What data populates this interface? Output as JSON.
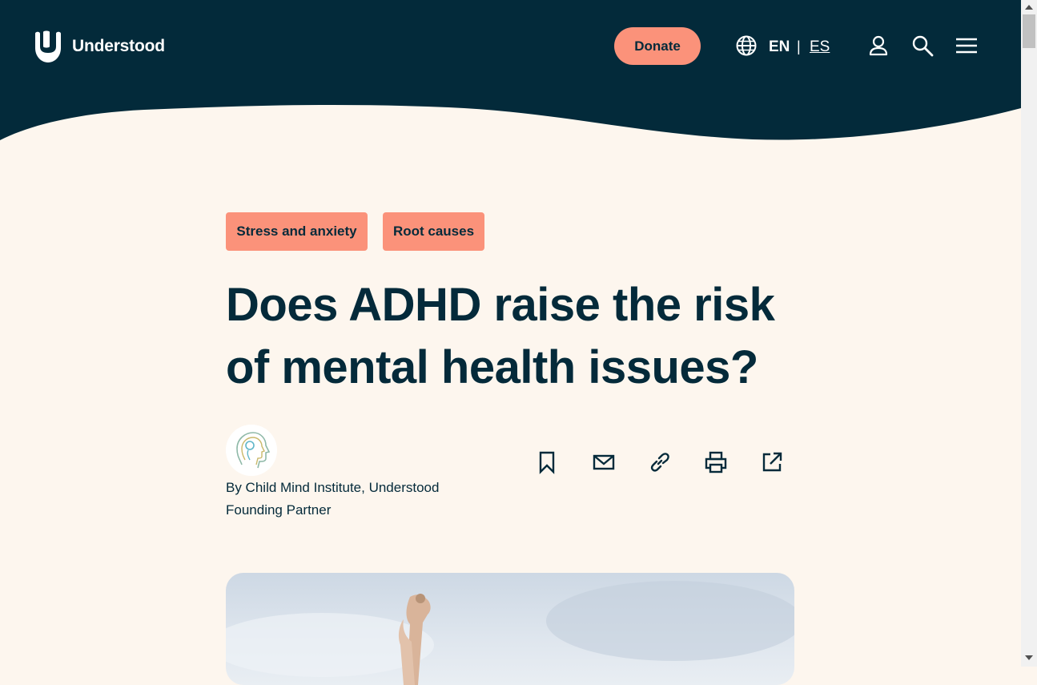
{
  "header": {
    "brand": "Understood",
    "donate_label": "Donate",
    "lang_current": "EN",
    "lang_separator": "|",
    "lang_other": "ES",
    "bg_color": "#032a3a",
    "accent_color": "#fb927a"
  },
  "tags": [
    "Stress and anxiety",
    "Root causes"
  ],
  "article": {
    "title": "Does ADHD raise the risk of mental health issues?",
    "byline": "By Child Mind Institute, Understood Founding Partner"
  },
  "share_icons": [
    "bookmark-icon",
    "email-icon",
    "link-icon",
    "print-icon",
    "external-share-icon"
  ],
  "hero_image": {
    "description": "hands-reaching-sky-icon"
  }
}
